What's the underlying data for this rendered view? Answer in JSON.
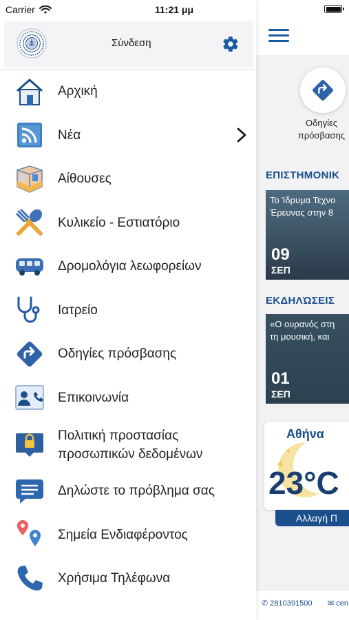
{
  "status_bar": {
    "carrier": "Carrier",
    "time": "11:21 μμ"
  },
  "drawer": {
    "header": {
      "login_label": "Σύνδεση"
    },
    "menu": [
      {
        "label": "Αρχική",
        "icon": "home-icon"
      },
      {
        "label": "Νέα",
        "icon": "rss-icon",
        "has_submenu": true
      },
      {
        "label": "Αίθουσες",
        "icon": "room-icon"
      },
      {
        "label": "Κυλικείο - Εστιατόριο",
        "icon": "cutlery-icon"
      },
      {
        "label": "Δρομολόγια λεωφορείων",
        "icon": "bus-icon"
      },
      {
        "label": "Ιατρείο",
        "icon": "stethoscope-icon"
      },
      {
        "label": "Οδηγίες πρόσβασης",
        "icon": "directions-icon"
      },
      {
        "label": "Επικοινωνία",
        "icon": "contact-icon"
      },
      {
        "label": "Πολιτική προστασίας",
        "label2": "προσωπικών δεδομένων",
        "icon": "privacy-lock-icon"
      },
      {
        "label": "Δηλώστε το πρόβλημα σας",
        "icon": "chat-icon"
      },
      {
        "label": "Σημεία Ενδιαφέροντος",
        "icon": "map-pins-icon"
      },
      {
        "label": "Χρήσιμα Τηλέφωνα",
        "icon": "phone-icon"
      }
    ]
  },
  "main": {
    "directions_label_1": "Οδηγίες",
    "directions_label_2": "πρόσβασης",
    "science_section": "ΕΠΙΣΤΗΜΟΝΙΚ",
    "science_card": {
      "line1": "Το Ίδρυμα Τεχνο",
      "line2": "Έρευνας στην 8",
      "day": "09",
      "month": "ΣΕΠ"
    },
    "events_section": "ΕΚΔΗΛΏΣΕΙΣ",
    "events_card": {
      "line1": "«Ο ουρανός στη",
      "line2": "τη μουσική, και",
      "day": "01",
      "month": "ΣΕΠ"
    },
    "weather": {
      "city": "Αθήνα",
      "temp": "23°C",
      "change_label": "Αλλαγή Π"
    },
    "footer": {
      "phone": "2810391500",
      "mail": "cen"
    }
  },
  "colors": {
    "accent": "#1a4f8c",
    "icon_blue": "#2b6cb0"
  }
}
